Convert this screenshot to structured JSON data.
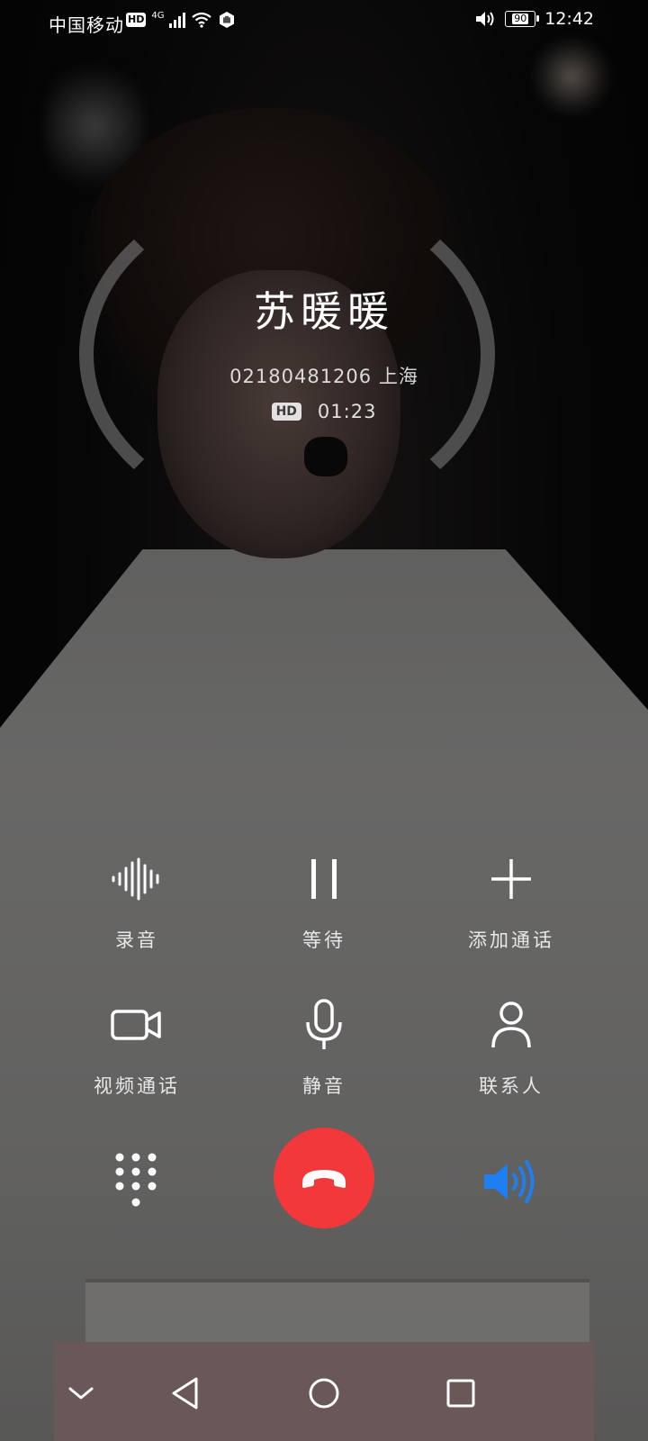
{
  "status_bar": {
    "carrier": "中国移动",
    "hd": "HD",
    "network": "4G",
    "battery": "90",
    "time": "12:42"
  },
  "call": {
    "name": "苏暖暖",
    "number_location": "02180481206 上海",
    "hd_badge": "HD",
    "duration": "01:23"
  },
  "actions": {
    "record": "录音",
    "hold": "等待",
    "add_call": "添加通话",
    "video_call": "视频通话",
    "mute": "静音",
    "contacts": "联系人"
  },
  "colors": {
    "hangup": "#f2383a",
    "speaker_active": "#1f7ef0"
  },
  "icons": [
    "record-waveform-icon",
    "pause-icon",
    "plus-icon",
    "video-camera-icon",
    "microphone-icon",
    "person-icon",
    "dialpad-icon",
    "phone-hangup-icon",
    "speaker-icon",
    "nav-down-icon",
    "nav-back-icon",
    "nav-home-icon",
    "nav-recents-icon"
  ]
}
